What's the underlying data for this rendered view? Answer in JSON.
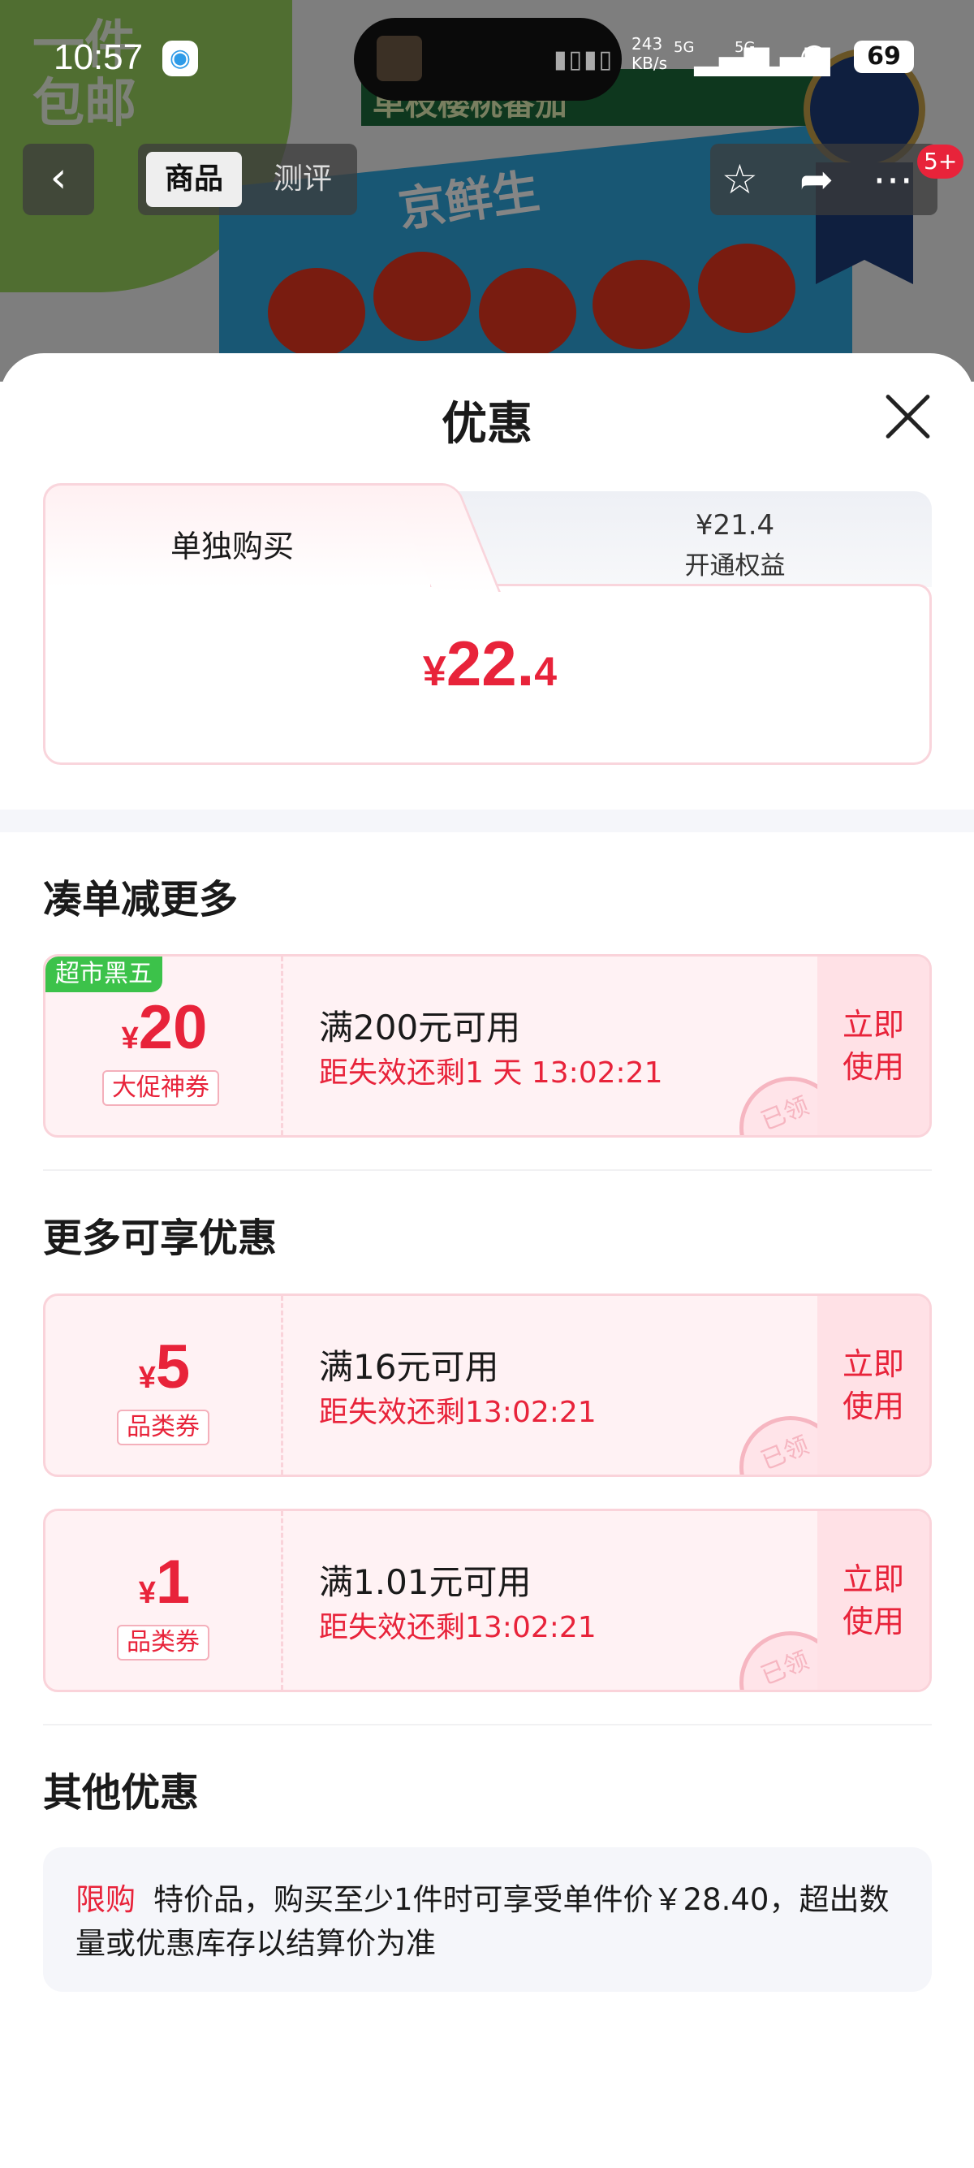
{
  "status_bar": {
    "time": "10:57",
    "net_speed": "243",
    "net_unit": "KB/s",
    "sig1": "5G",
    "sig2": "5G",
    "battery": "69"
  },
  "background": {
    "corner_text": "一件\n包邮",
    "banner": "单枝樱桃番茄",
    "brand": "京鲜生"
  },
  "nav": {
    "tab_active": "商品",
    "tab_other": "测评",
    "badge": "5+"
  },
  "sheet": {
    "title": "优惠",
    "price_tabs": {
      "tab1_label": "单独购买",
      "tab2_price": "¥21.4",
      "tab2_label": "开通权益"
    },
    "price": {
      "currency": "¥",
      "int": "22.",
      "dec": "4"
    },
    "section1_title": "凑单减更多",
    "section2_title": "更多可享优惠",
    "section3_title": "其他优惠",
    "coupons": [
      {
        "tag": "超市黑五",
        "currency": "¥",
        "amount": "20",
        "type": "大促神券",
        "condition": "满200元可用",
        "expiry": "距失效还剩1 天 13:02:21",
        "use_label": "立即使用",
        "stamp": "已领"
      },
      {
        "currency": "¥",
        "amount": "5",
        "type": "品类券",
        "condition": "满16元可用",
        "expiry": "距失效还剩13:02:21",
        "use_label": "立即使用",
        "stamp": "已领"
      },
      {
        "currency": "¥",
        "amount": "1",
        "type": "品类券",
        "condition": "满1.01元可用",
        "expiry": "距失效还剩13:02:21",
        "use_label": "立即使用",
        "stamp": "已领"
      }
    ],
    "other": {
      "tag": "限购",
      "text": "特价品，购买至少1件时可享受单件价￥28.40，超出数量或优惠库存以结算价为准"
    }
  },
  "colors": {
    "accent": "#e8233a",
    "coupon_bg": "#fff2f4",
    "tag_green": "#3cc24a"
  }
}
